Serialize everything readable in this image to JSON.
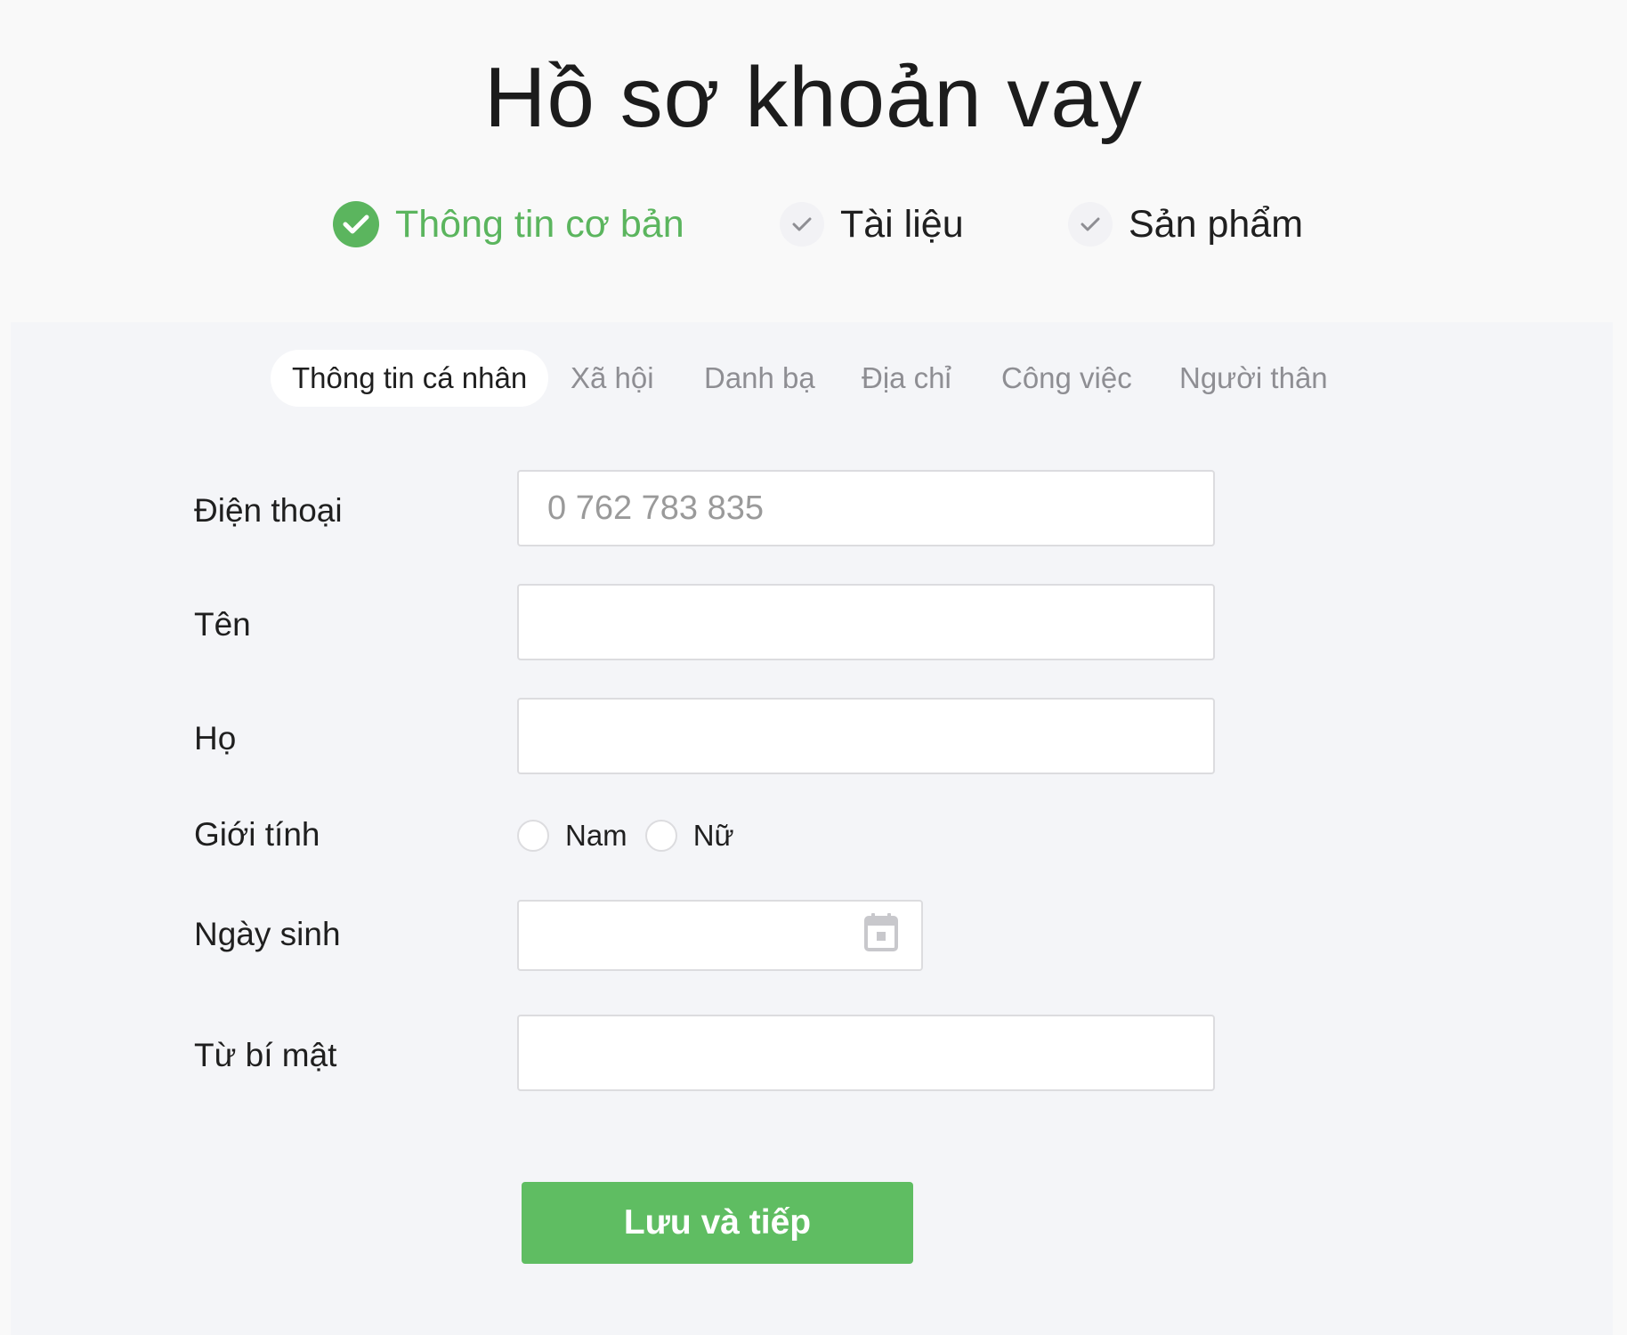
{
  "page": {
    "title": "Hồ sơ khoản vay"
  },
  "stepper": {
    "steps": [
      {
        "label": "Thông tin cơ bản",
        "state": "completed",
        "icon": "check-circle-icon",
        "color": "#5bb55e"
      },
      {
        "label": "Tài liệu",
        "state": "pending",
        "icon": "check-icon"
      },
      {
        "label": "Sản phẩm",
        "state": "pending",
        "icon": "check-icon"
      }
    ]
  },
  "tabs": {
    "items": [
      {
        "label": "Thông tin cá nhân",
        "active": true
      },
      {
        "label": "Xã hội",
        "active": false
      },
      {
        "label": "Danh bạ",
        "active": false
      },
      {
        "label": "Địa chỉ",
        "active": false
      },
      {
        "label": "Công việc",
        "active": false
      },
      {
        "label": "Người thân",
        "active": false
      }
    ]
  },
  "form": {
    "phone": {
      "label": "Điện thoại",
      "placeholder": "0 762 783 835",
      "value": ""
    },
    "first_name": {
      "label": "Tên",
      "value": ""
    },
    "last_name": {
      "label": "Họ",
      "value": ""
    },
    "gender": {
      "label": "Giới tính",
      "options": [
        "Nam",
        "Nữ"
      ],
      "selected": null
    },
    "birthday": {
      "label": "Ngày sinh",
      "value": "",
      "icon": "calendar-icon"
    },
    "secret_word": {
      "label": "Từ bí mật",
      "value": ""
    }
  },
  "actions": {
    "submit_label": "Lưu và tiếp",
    "submit_color": "#5fbd62"
  }
}
